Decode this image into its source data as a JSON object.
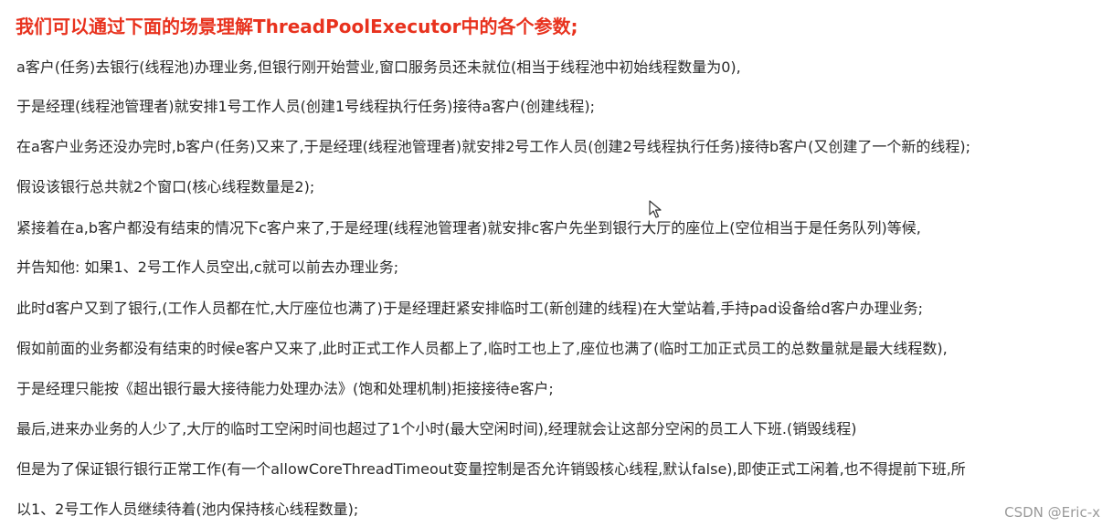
{
  "title": "我们可以通过下面的场景理解ThreadPoolExecutor中的各个参数;",
  "lines": [
    "a客户(任务)去银行(线程池)办理业务,但银行刚开始营业,窗口服务员还未就位(相当于线程池中初始线程数量为0),",
    "于是经理(线程池管理者)就安排1号工作人员(创建1号线程执行任务)接待a客户(创建线程);",
    "在a客户业务还没办完时,b客户(任务)又来了,于是经理(线程池管理者)就安排2号工作人员(创建2号线程执行任务)接待b客户(又创建了一个新的线程);",
    "假设该银行总共就2个窗口(核心线程数量是2);",
    "紧接着在a,b客户都没有结束的情况下c客户来了,于是经理(线程池管理者)就安排c客户先坐到银行大厅的座位上(空位相当于是任务队列)等候,",
    "并告知他: 如果1、2号工作人员空出,c就可以前去办理业务;",
    "此时d客户又到了银行,(工作人员都在忙,大厅座位也满了)于是经理赶紧安排临时工(新创建的线程)在大堂站着,手持pad设备给d客户办理业务;",
    "假如前面的业务都没有结束的时候e客户又来了,此时正式工作人员都上了,临时工也上了,座位也满了(临时工加正式员工的总数量就是最大线程数),",
    "于是经理只能按《超出银行最大接待能力处理办法》(饱和处理机制)拒接接待e客户;",
    "最后,进来办业务的人少了,大厅的临时工空闲时间也超过了1个小时(最大空闲时间),经理就会让这部分空闲的员工人下班.(销毁线程)",
    "但是为了保证银行银行正常工作(有一个allowCoreThreadTimeout变量控制是否允许销毁核心线程,默认false),即使正式工闲着,也不得提前下班,所",
    "以1、2号工作人员继续待着(池内保持核心线程数量);"
  ],
  "watermark": "CSDN @Eric-x",
  "colors": {
    "title": "#e8321e",
    "body_text": "#2a2a2a",
    "watermark": "#9a9a9a"
  },
  "cursor_icon": "arrow-cursor-icon"
}
